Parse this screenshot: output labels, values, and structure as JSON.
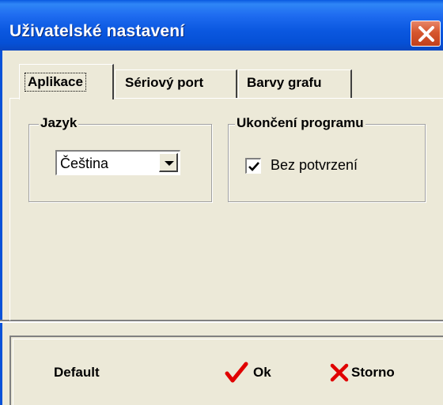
{
  "window": {
    "title": "Uživatelské nastavení"
  },
  "tabs": [
    {
      "label": "Aplikace",
      "active": true
    },
    {
      "label": "Sériový port",
      "active": false
    },
    {
      "label": "Barvy grafu",
      "active": false
    }
  ],
  "language_group": {
    "title": "Jazyk",
    "selected": "Čeština"
  },
  "exit_group": {
    "title": "Ukončení programu",
    "checkbox_label": "Bez potvrzení",
    "checked": true
  },
  "buttons": {
    "default": "Default",
    "ok": "Ok",
    "cancel": "Storno"
  },
  "colors": {
    "title_bar": "#0b58e0",
    "close_red": "#d6562e",
    "ok_check": "#e00000",
    "cancel_x": "#e00000",
    "face": "#ece9d8"
  },
  "icons": {
    "close": "close-icon",
    "ok": "checkmark-icon",
    "cancel": "x-icon",
    "dropdown": "chevron-down-icon"
  }
}
